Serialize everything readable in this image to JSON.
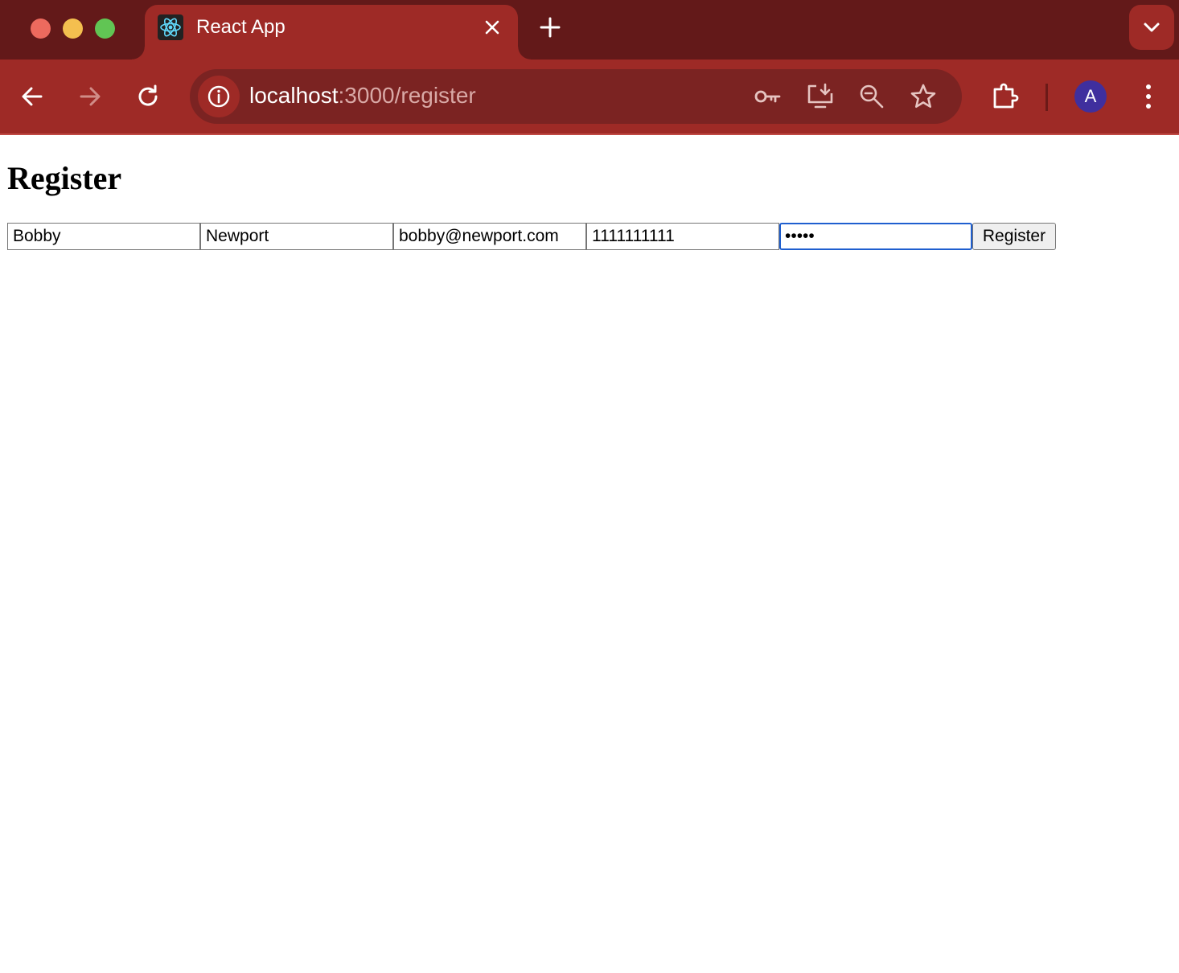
{
  "browser": {
    "tab": {
      "title": "React App",
      "favicon": "react-logo-icon"
    },
    "address_bar": {
      "host": "localhost",
      "path": ":3000/register"
    },
    "profile_initial": "A",
    "colors": {
      "frame": "#631919",
      "toolbar": "#9e2a26",
      "omnibox": "#7b2322",
      "avatar": "#3f2f9e"
    }
  },
  "page": {
    "heading": "Register",
    "fields": {
      "first_name": "Bobby",
      "last_name": "Newport",
      "email": "bobby@newport.com",
      "phone": "1111111111",
      "password": "•••••"
    },
    "submit_label": "Register",
    "focus_color": "#1f5fcf"
  }
}
